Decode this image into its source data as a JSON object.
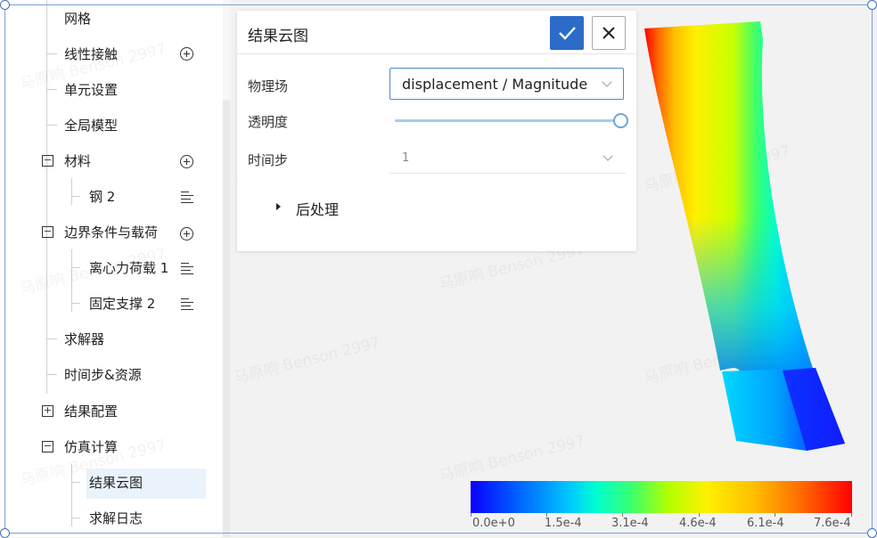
{
  "tree": {
    "items": [
      {
        "label": "网格",
        "action": ""
      },
      {
        "label": "线性接触",
        "action": "add"
      },
      {
        "label": "单元设置",
        "action": ""
      },
      {
        "label": "全局模型",
        "action": ""
      },
      {
        "label": "材料",
        "action": "add",
        "expander": "collapse"
      },
      {
        "label": "钢 2",
        "action": "detail"
      },
      {
        "label": "边界条件与载荷",
        "action": "add",
        "expander": "collapse"
      },
      {
        "label": "离心力荷载 1",
        "action": "detail"
      },
      {
        "label": "固定支撑 2",
        "action": "detail"
      },
      {
        "label": "求解器",
        "action": ""
      },
      {
        "label": "时间步&资源",
        "action": ""
      },
      {
        "label": "结果配置",
        "action": "",
        "expander": "expand"
      },
      {
        "label": "仿真计算",
        "action": "",
        "expander": "collapse"
      },
      {
        "label": "结果云图",
        "action": "",
        "selected": true
      },
      {
        "label": "求解日志",
        "action": ""
      }
    ],
    "expander_symbols": {
      "collapse": "−",
      "expand": "+"
    }
  },
  "panel": {
    "title": "结果云图",
    "ok_icon": "check-icon",
    "close_icon": "close-icon",
    "field_label": "物理场",
    "field_value": "displacement / Magnitude",
    "opacity_label": "透明度",
    "opacity_value": 1.0,
    "timestep_label": "时间步",
    "timestep_value": "1",
    "postprocess_label": "后处理"
  },
  "colorbar": {
    "ticks": [
      "0.0e+0",
      "1.5e-4",
      "3.1e-4",
      "4.6e-4",
      "6.1e-4",
      "7.6e-4"
    ],
    "colors": [
      "#0a00ff",
      "#00c8ff",
      "#39ff70",
      "#fff000",
      "#ffc000",
      "#ff0000"
    ]
  },
  "watermark": "马原响 Benson 2997"
}
